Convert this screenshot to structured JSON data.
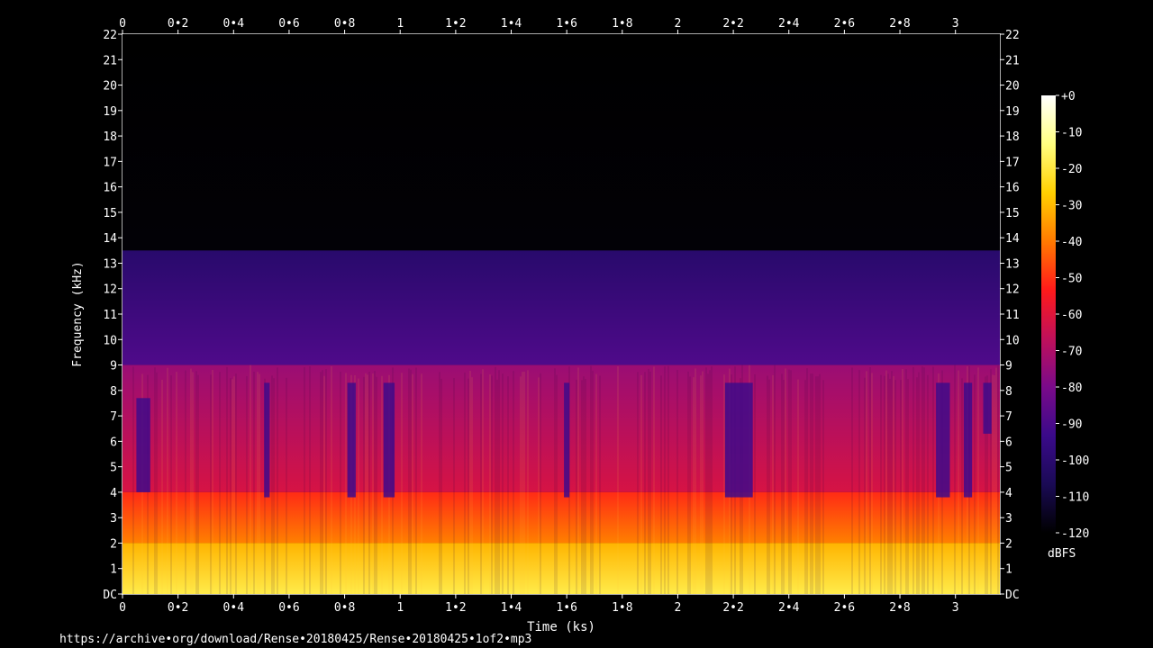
{
  "footer": {
    "source_url": "https://archive•org/download/Rense•20180425/Rense•20180425•1of2•mp3"
  },
  "chart_data": {
    "type": "heatmap",
    "title": "",
    "xlabel": "Time (ks)",
    "ylabel": "Frequency (kHz)",
    "x_range": [
      0,
      3.16
    ],
    "y_range": [
      0,
      22
    ],
    "x_ticks": [
      {
        "value": 0,
        "label": "0"
      },
      {
        "value": 0.2,
        "label": "0•2"
      },
      {
        "value": 0.4,
        "label": "0•4"
      },
      {
        "value": 0.6,
        "label": "0•6"
      },
      {
        "value": 0.8,
        "label": "0•8"
      },
      {
        "value": 1.0,
        "label": "1"
      },
      {
        "value": 1.2,
        "label": "1•2"
      },
      {
        "value": 1.4,
        "label": "1•4"
      },
      {
        "value": 1.6,
        "label": "1•6"
      },
      {
        "value": 1.8,
        "label": "1•8"
      },
      {
        "value": 2.0,
        "label": "2"
      },
      {
        "value": 2.2,
        "label": "2•2"
      },
      {
        "value": 2.4,
        "label": "2•4"
      },
      {
        "value": 2.6,
        "label": "2•6"
      },
      {
        "value": 2.8,
        "label": "2•8"
      },
      {
        "value": 3.0,
        "label": "3"
      }
    ],
    "y_ticks": [
      {
        "value": 0,
        "label": "DC"
      },
      {
        "value": 1,
        "label": "1"
      },
      {
        "value": 2,
        "label": "2"
      },
      {
        "value": 3,
        "label": "3"
      },
      {
        "value": 4,
        "label": "4"
      },
      {
        "value": 5,
        "label": "5"
      },
      {
        "value": 6,
        "label": "6"
      },
      {
        "value": 7,
        "label": "7"
      },
      {
        "value": 8,
        "label": "8"
      },
      {
        "value": 9,
        "label": "9"
      },
      {
        "value": 10,
        "label": "10"
      },
      {
        "value": 11,
        "label": "11"
      },
      {
        "value": 12,
        "label": "12"
      },
      {
        "value": 13,
        "label": "13"
      },
      {
        "value": 14,
        "label": "14"
      },
      {
        "value": 15,
        "label": "15"
      },
      {
        "value": 16,
        "label": "16"
      },
      {
        "value": 17,
        "label": "17"
      },
      {
        "value": 18,
        "label": "18"
      },
      {
        "value": 19,
        "label": "19"
      },
      {
        "value": 20,
        "label": "20"
      },
      {
        "value": 21,
        "label": "21"
      },
      {
        "value": 22,
        "label": "22"
      }
    ],
    "colorbar": {
      "unit_label": "dBFS",
      "range": [
        -120,
        0
      ],
      "ticks": [
        {
          "value": 0,
          "label": "+0"
        },
        {
          "value": -10,
          "label": "-10"
        },
        {
          "value": -20,
          "label": "-20"
        },
        {
          "value": -30,
          "label": "-30"
        },
        {
          "value": -40,
          "label": "-40"
        },
        {
          "value": -50,
          "label": "-50"
        },
        {
          "value": -60,
          "label": "-60"
        },
        {
          "value": -70,
          "label": "-70"
        },
        {
          "value": -80,
          "label": "-80"
        },
        {
          "value": -90,
          "label": "-90"
        },
        {
          "value": -100,
          "label": "-100"
        },
        {
          "value": -110,
          "label": "-110"
        },
        {
          "value": -120,
          "label": "-120"
        }
      ],
      "colors": [
        "#000000",
        "#1a0a55",
        "#3a0a8a",
        "#7a0a8a",
        "#c0105a",
        "#ff1a1a",
        "#ff7a00",
        "#ffd000",
        "#ffff80",
        "#ffffff"
      ]
    },
    "bands": [
      {
        "from_khz": 13.5,
        "to_khz": 22,
        "level_db": -125
      },
      {
        "from_khz": 9,
        "to_khz": 13.5,
        "level_db": -95
      },
      {
        "from_khz": 4,
        "to_khz": 9,
        "level_db": -68
      },
      {
        "from_khz": 2,
        "to_khz": 4,
        "level_db": -45
      },
      {
        "from_khz": 0,
        "to_khz": 2,
        "level_db": -25
      }
    ],
    "dropouts": [
      {
        "start_ks": 0.05,
        "end_ks": 0.1,
        "from_khz": 4,
        "to_khz": 7.7
      },
      {
        "start_ks": 0.51,
        "end_ks": 0.53,
        "from_khz": 3.8,
        "to_khz": 8.3
      },
      {
        "start_ks": 0.81,
        "end_ks": 0.84,
        "from_khz": 3.8,
        "to_khz": 8.3
      },
      {
        "start_ks": 0.94,
        "end_ks": 0.98,
        "from_khz": 3.8,
        "to_khz": 8.3
      },
      {
        "start_ks": 1.59,
        "end_ks": 1.61,
        "from_khz": 3.8,
        "to_khz": 8.3
      },
      {
        "start_ks": 2.17,
        "end_ks": 2.27,
        "from_khz": 3.8,
        "to_khz": 8.3
      },
      {
        "start_ks": 2.93,
        "end_ks": 2.98,
        "from_khz": 3.8,
        "to_khz": 8.3
      },
      {
        "start_ks": 3.03,
        "end_ks": 3.06,
        "from_khz": 3.8,
        "to_khz": 8.3
      },
      {
        "start_ks": 3.1,
        "end_ks": 3.13,
        "from_khz": 6.3,
        "to_khz": 8.3
      }
    ],
    "grid": false,
    "legend": "right colorbar"
  }
}
